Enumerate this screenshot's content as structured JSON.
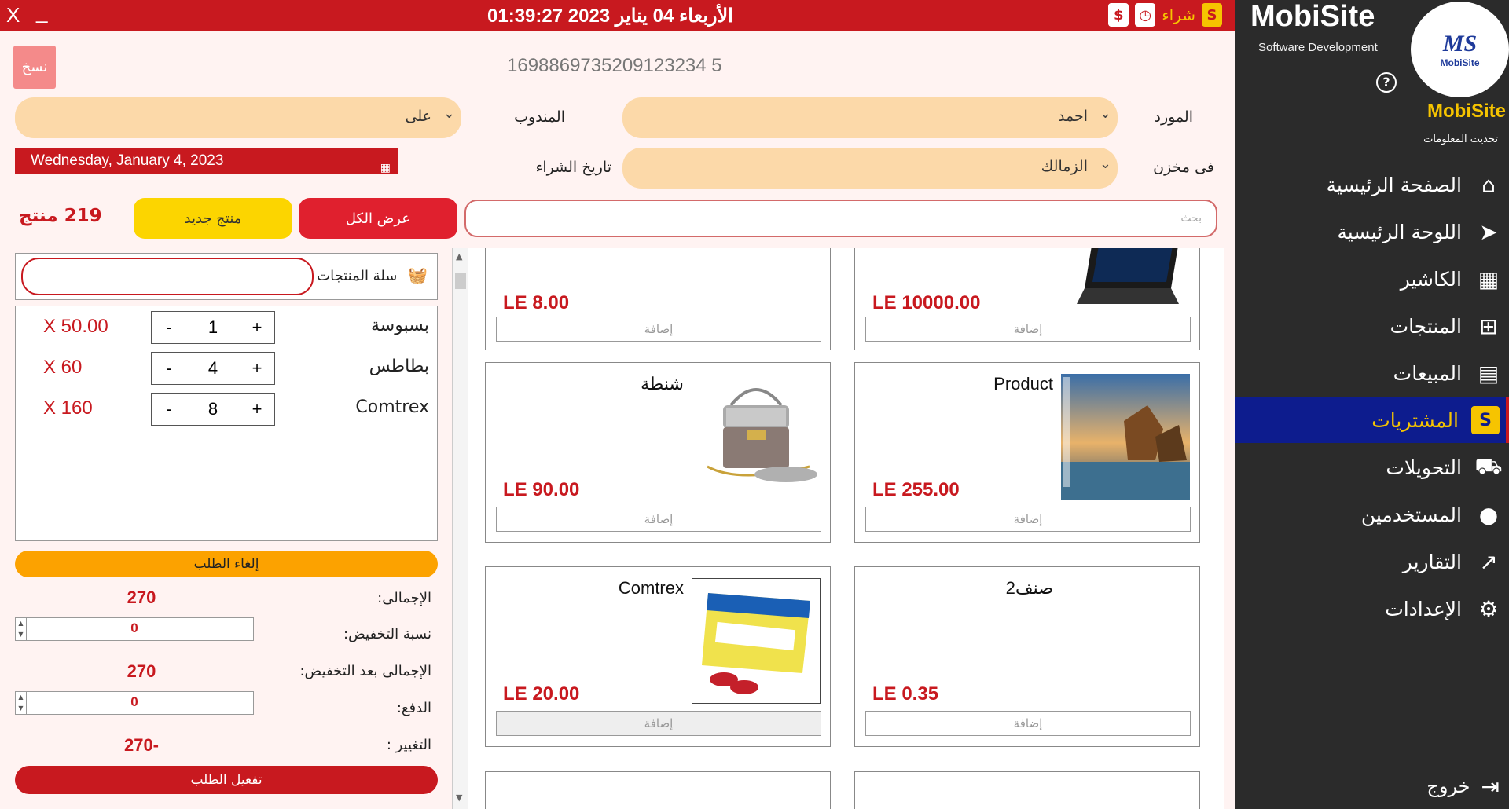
{
  "titlebar": {
    "close": "X",
    "minimize": "_",
    "datetime": "الأربعاء 04 يناير 2023  01:39:27",
    "buy_label": "شراء"
  },
  "header": {
    "copy_label": "نسخ",
    "order_number": "1698869735209123234 5"
  },
  "form": {
    "supplier_label": "المورد",
    "supplier_value": "احمد",
    "rep_label": "المندوب",
    "rep_value": "على",
    "store_label": "فى مخزن",
    "store_value": "الزمالك",
    "purchase_date_label": "تاريخ الشراء",
    "purchase_date_value": "Wednesday, January 4, 2023"
  },
  "toolbar": {
    "product_count": "219 منتج",
    "new_product": "منتج جديد",
    "show_all": "عرض الكل",
    "search_placeholder": "بحث"
  },
  "cart": {
    "title": "سلة المنتجات",
    "items": [
      {
        "name": "بسبوسة",
        "qty": "1",
        "price": "X  50.00"
      },
      {
        "name": "بطاطس",
        "qty": "4",
        "price": "X  60"
      },
      {
        "name": "Comtrex",
        "qty": "8",
        "price": "X  160"
      }
    ],
    "minus": "-",
    "plus": "+"
  },
  "summary": {
    "cancel": "إلغاء الطلب",
    "total_label": "الإجمالى:",
    "total_value": "270",
    "discount_label": "نسبة التخفيض:",
    "discount_value": "0",
    "total_after_label": "الإجمالى بعد التخفيض:",
    "total_after_value": "270",
    "paid_label": "الدفع:",
    "paid_value": "0",
    "change_label": "التغيير :",
    "change_value": "270-",
    "activate": "تفعيل الطلب"
  },
  "products": [
    {
      "name": "",
      "price": "LE 10000.00",
      "add": "إضافة",
      "image": "laptop"
    },
    {
      "name": "",
      "price": "LE 8.00",
      "add": "إضافة",
      "image": ""
    },
    {
      "name": "Product",
      "price": "LE 255.00",
      "add": "إضافة",
      "image": "landscape"
    },
    {
      "name": "شنطة",
      "price": "LE 90.00",
      "add": "إضافة",
      "image": "handbag"
    },
    {
      "name": "صنف2",
      "price": "LE 0.35",
      "add": "إضافة",
      "image": ""
    },
    {
      "name": "Comtrex",
      "price": "LE 20.00",
      "add": "إضافة",
      "image": "comtrex-box"
    }
  ],
  "sidebar": {
    "brand": "MobiSite",
    "brand_sub": "Software Development",
    "logo_text": "MS",
    "logo_sub": "MobiSite",
    "brand2": "MobiSite",
    "update": "تحديث المعلومات",
    "items": [
      {
        "label": "الصفحة الرئيسية",
        "icon": "home-icon"
      },
      {
        "label": "اللوحة الرئيسية",
        "icon": "send-icon"
      },
      {
        "label": "الكاشير",
        "icon": "boxes-icon"
      },
      {
        "label": "المنتجات",
        "icon": "basket-icon"
      },
      {
        "label": "المبيعات",
        "icon": "card-icon"
      },
      {
        "label": "المشتريات",
        "icon": "shopify-icon"
      },
      {
        "label": "التحويلات",
        "icon": "truck-icon"
      },
      {
        "label": "المستخدمين",
        "icon": "user-icon"
      },
      {
        "label": "التقارير",
        "icon": "chart-icon"
      },
      {
        "label": "الإعدادات",
        "icon": "gear-icon"
      }
    ],
    "exit": "خروج"
  },
  "colors": {
    "accent": "#c8191f",
    "sidebar": "#2b2b2b",
    "active": "#0d1c8e",
    "yellow": "#f6c400"
  }
}
